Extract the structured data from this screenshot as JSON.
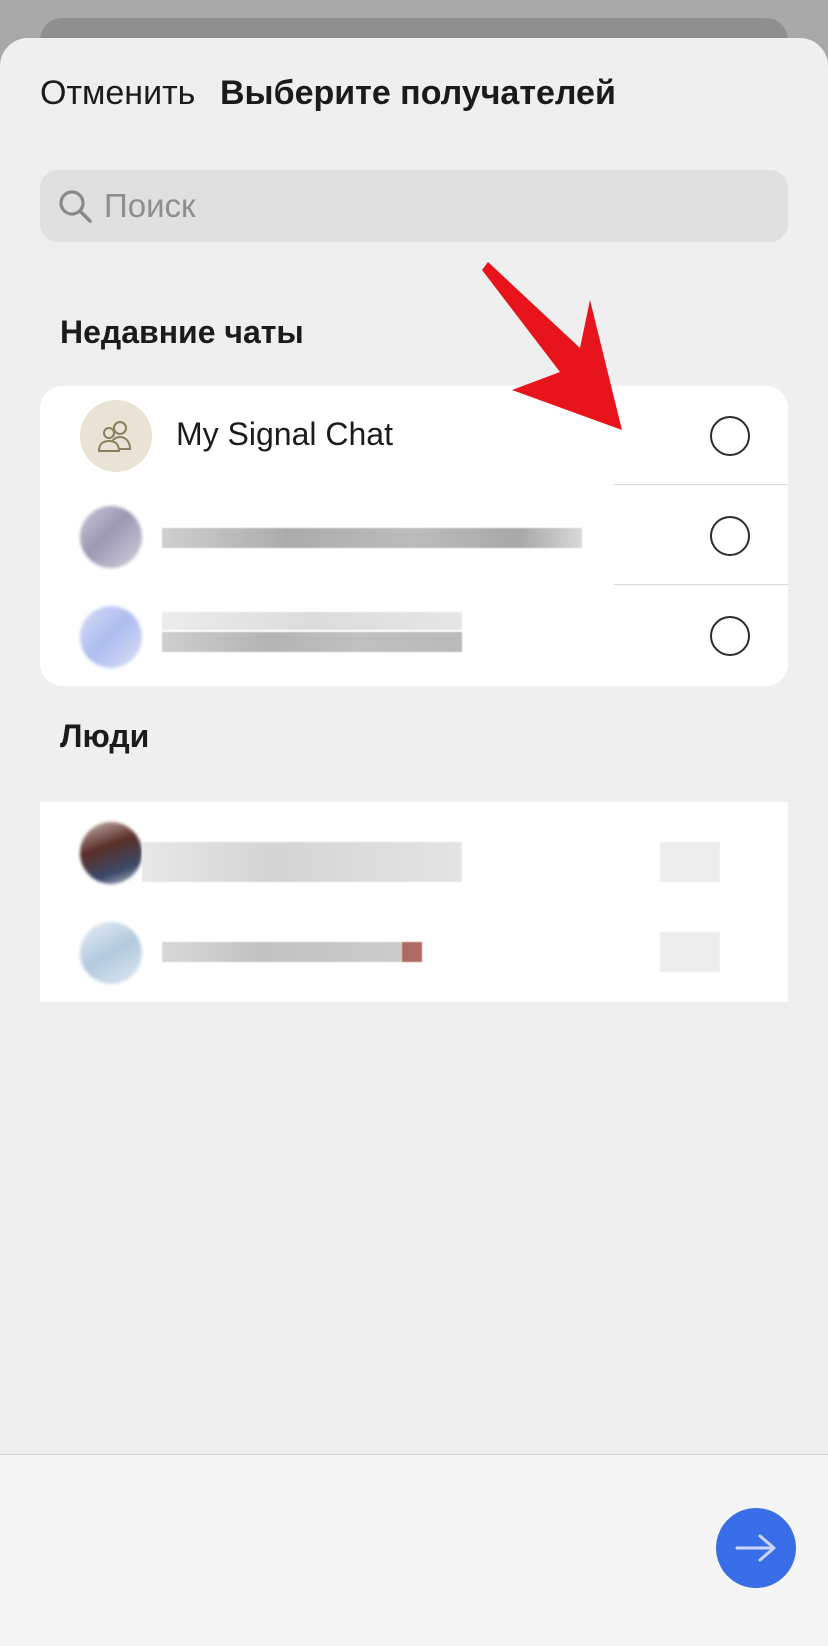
{
  "header": {
    "cancel_label": "Отменить",
    "title": "Выберите получателей"
  },
  "search": {
    "placeholder": "Поиск"
  },
  "recent": {
    "title": "Недавние чаты",
    "items": [
      {
        "name": "My Signal Chat",
        "avatar": "group-icon",
        "selected": false
      },
      {
        "name": "",
        "selected": false
      },
      {
        "name": "",
        "selected": false
      }
    ]
  },
  "people": {
    "title": "Люди"
  },
  "colors": {
    "accent": "#3a6ee8",
    "annotation_arrow": "#e8141c",
    "group_avatar_bg": "#e8e3d4"
  },
  "icons": {
    "search": "search-icon",
    "send": "arrow-right-icon"
  }
}
